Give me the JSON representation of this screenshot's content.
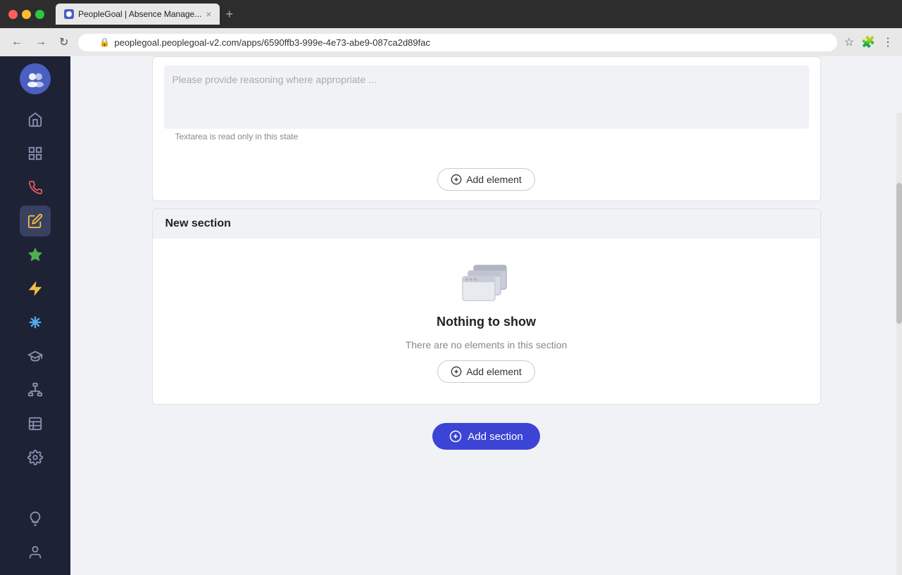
{
  "browser": {
    "traffic_lights": [
      "red",
      "yellow",
      "green"
    ],
    "tab": {
      "title": "PeopleGoal | Absence Manage...",
      "favicon_label": "PG"
    },
    "new_tab_label": "+",
    "address": {
      "protocol": "https",
      "url": "peoplegoal.peoplegoal-v2.com/apps/6590ffb3-999e-4e73-abe9-087ca2d89fac"
    },
    "toolbar_icons": [
      "star",
      "puzzle",
      "menu"
    ]
  },
  "sidebar": {
    "logo_icon": "users-icon",
    "items": [
      {
        "name": "home-icon",
        "icon": "🏠",
        "active": false
      },
      {
        "name": "dashboard-icon",
        "icon": "▦",
        "active": false
      },
      {
        "name": "inbox-icon",
        "icon": "📥",
        "active": false
      },
      {
        "name": "edit-icon",
        "icon": "✏️",
        "active": true
      },
      {
        "name": "star-icon",
        "icon": "★",
        "active": false
      },
      {
        "name": "bolt-icon",
        "icon": "⚡",
        "active": false
      },
      {
        "name": "asterisk-icon",
        "icon": "✳",
        "active": false
      },
      {
        "name": "graduation-icon",
        "icon": "🎓",
        "active": false
      },
      {
        "name": "org-icon",
        "icon": "⊞",
        "active": false
      },
      {
        "name": "table-icon",
        "icon": "▤",
        "active": false
      },
      {
        "name": "settings-icon",
        "icon": "⚙",
        "active": false
      }
    ],
    "bottom_items": [
      {
        "name": "bulb-icon",
        "icon": "💡"
      },
      {
        "name": "user-icon",
        "icon": "👤"
      }
    ]
  },
  "main": {
    "textarea_placeholder": "Please provide reasoning where appropriate ...",
    "textarea_hint": "Textarea is read only in this state",
    "add_element_label": "Add element",
    "new_section": {
      "title": "New section",
      "empty_icon": "stacked-windows-icon",
      "nothing_to_show": "Nothing to show",
      "nothing_desc": "There are no elements in this section",
      "add_element_label": "Add element"
    },
    "add_section_label": "Add section"
  }
}
